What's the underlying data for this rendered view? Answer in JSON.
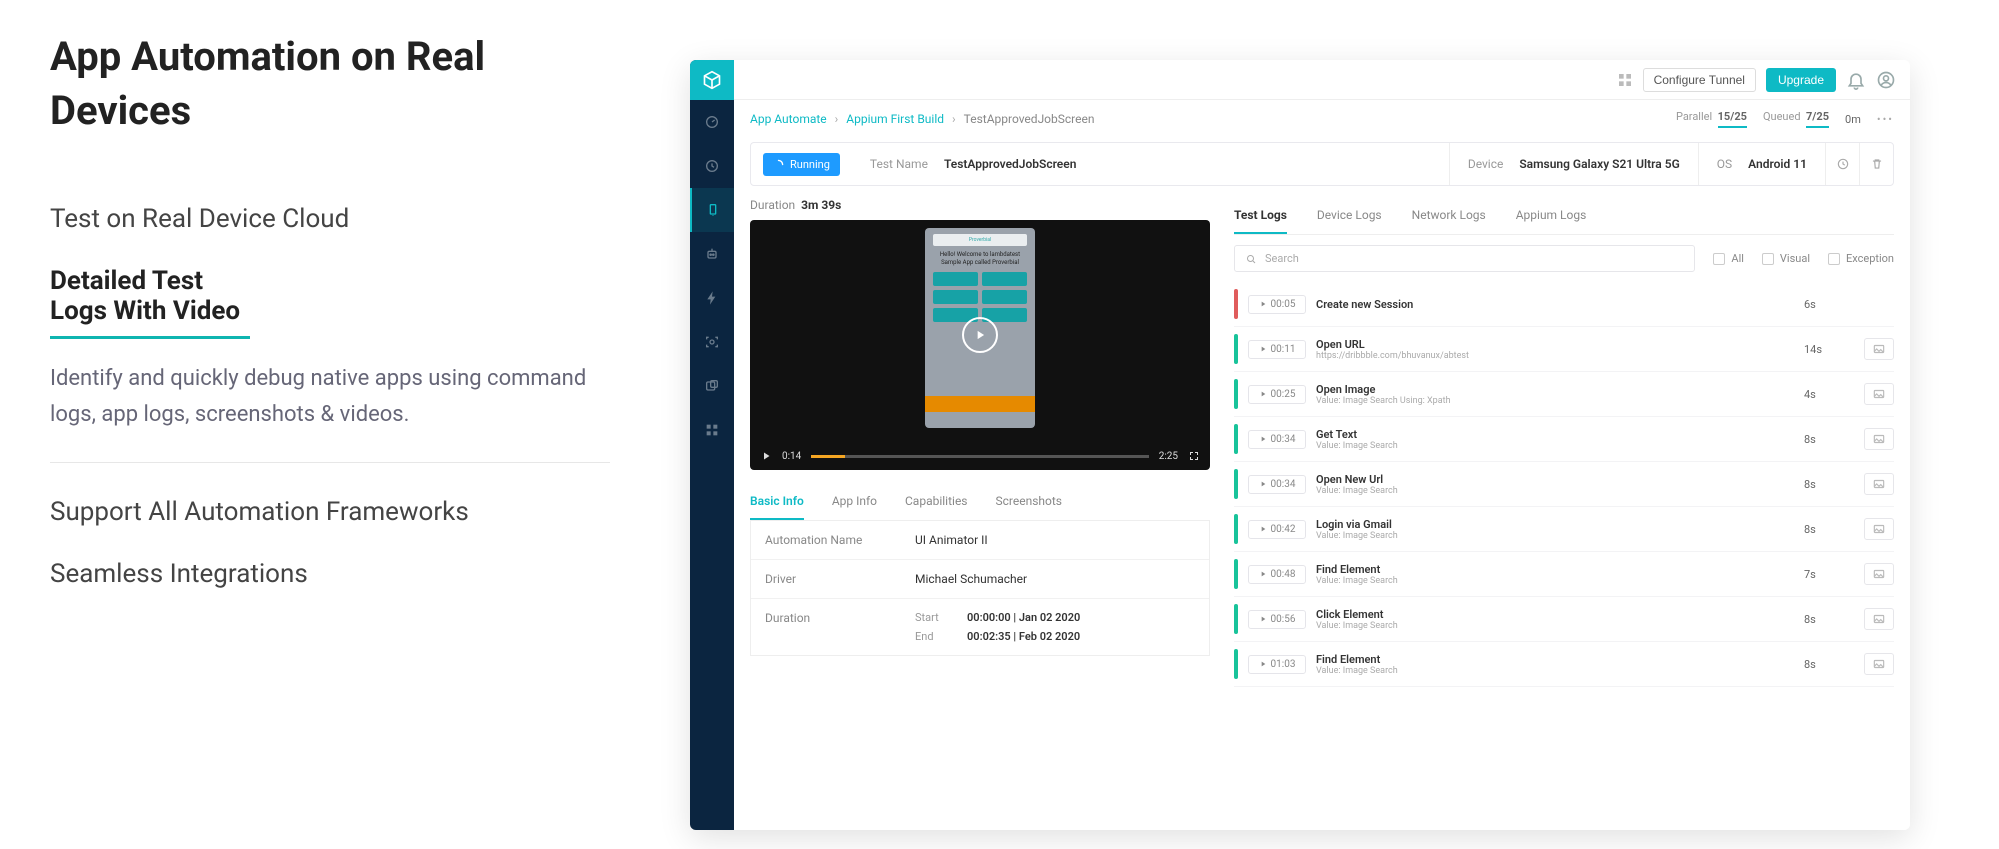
{
  "marketing": {
    "heading": "App Automation on Real Devices",
    "features": [
      "Test on Real Device Cloud",
      "Detailed Test Logs With Video",
      "Support All Automation Frameworks",
      "Seamless Integrations"
    ],
    "active_feature": "Detailed Test Logs With Video",
    "description": "Identify and quickly debug native apps using command logs, app logs, screenshots & videos."
  },
  "topbar": {
    "configure": "Configure Tunnel",
    "upgrade": "Upgrade"
  },
  "breadcrumb": {
    "a": "App Automate",
    "b": "Appium First Build",
    "c": "TestApprovedJobScreen"
  },
  "queue": {
    "parallel_label": "Parallel",
    "parallel_value": "15/25",
    "queued_label": "Queued",
    "queued_value": "7/25",
    "time": "0m"
  },
  "test": {
    "status": "Running",
    "name_label": "Test Name",
    "name_value": "TestApprovedJobScreen",
    "device_label": "Device",
    "device_value": "Samsung Galaxy S21 Ultra 5G",
    "os_label": "OS",
    "os_value": "Android 11"
  },
  "video": {
    "duration_label": "Duration",
    "duration_value": "3m 39s",
    "current": "0:14",
    "total": "2:25",
    "phone_appbar": "Proverbial",
    "phone_msg": "Hello! Welcome to lambdatest Sample App called Proverbial"
  },
  "info_tabs": [
    "Basic Info",
    "App Info",
    "Capabilities",
    "Screenshots"
  ],
  "basic_info": {
    "rows": [
      {
        "k": "Automation Name",
        "v": "UI Animator II"
      },
      {
        "k": "Driver",
        "v": "Michael Schumacher"
      }
    ],
    "duration_key": "Duration",
    "start_label": "Start",
    "start_value": "00:00:00 | Jan 02 2020",
    "end_label": "End",
    "end_value": "00:02:35 | Feb 02 2020"
  },
  "log_tabs": [
    "Test Logs",
    "Device Logs",
    "Network Logs",
    "Appium Logs"
  ],
  "search_placeholder": "Search",
  "filters": [
    "All",
    "Visual",
    "Exception"
  ],
  "logs": [
    {
      "color": "red",
      "time": "00:05",
      "title": "Create new Session",
      "sub": "",
      "dur": "6s",
      "thumb": false
    },
    {
      "color": "green",
      "time": "00:11",
      "title": "Open URL",
      "sub": "https://dribbble.com/bhuvanux/abtest",
      "dur": "14s",
      "thumb": true
    },
    {
      "color": "green",
      "time": "00:25",
      "title": "Open Image",
      "sub": "Value: Image Search   Using: Xpath",
      "dur": "4s",
      "thumb": true
    },
    {
      "color": "green",
      "time": "00:34",
      "title": "Get Text",
      "sub": "Value: Image Search",
      "dur": "8s",
      "thumb": true
    },
    {
      "color": "green",
      "time": "00:34",
      "title": "Open New Url",
      "sub": "Value: Image Search",
      "dur": "8s",
      "thumb": true
    },
    {
      "color": "green",
      "time": "00:42",
      "title": "Login via Gmail",
      "sub": "Value: Image Search",
      "dur": "8s",
      "thumb": true
    },
    {
      "color": "green",
      "time": "00:48",
      "title": "Find Element",
      "sub": "Value: Image Search",
      "dur": "7s",
      "thumb": true
    },
    {
      "color": "green",
      "time": "00:56",
      "title": "Click Element",
      "sub": "Value: Image Search",
      "dur": "8s",
      "thumb": true
    },
    {
      "color": "green",
      "time": "01:03",
      "title": "Find Element",
      "sub": "Value: Image Search",
      "dur": "8s",
      "thumb": true
    }
  ]
}
